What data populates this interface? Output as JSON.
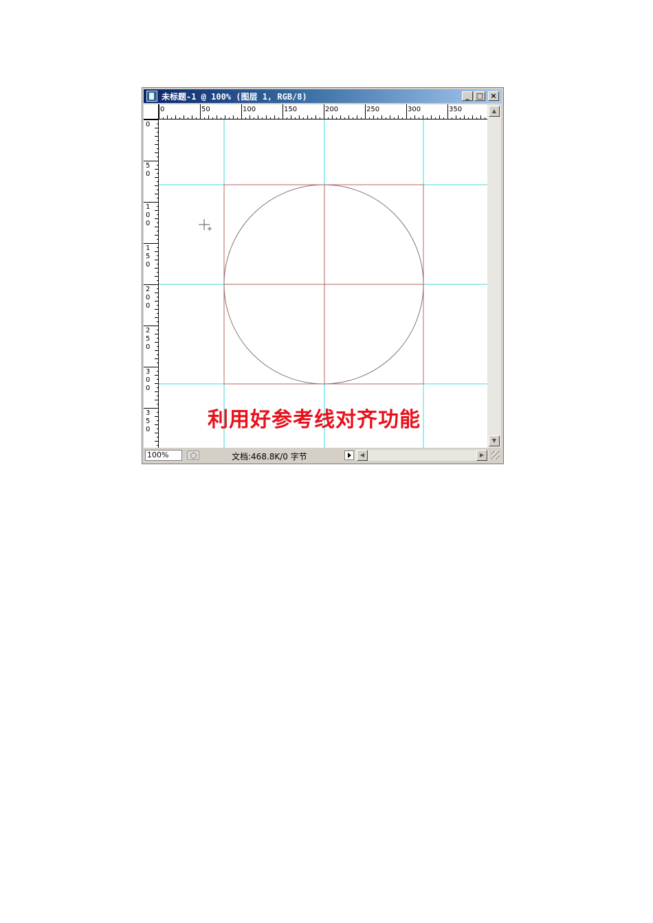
{
  "window": {
    "title": "未标题-1 @ 100% (图层 1, RGB/8)",
    "buttons": {
      "minimize": "_",
      "maximize": "□",
      "close": "×"
    }
  },
  "rulers": {
    "horizontal_labels": [
      "0",
      "50",
      "100",
      "150",
      "200",
      "250",
      "300",
      "350"
    ],
    "vertical_labels": [
      [
        "0"
      ],
      [
        "5",
        "0"
      ],
      [
        "1",
        "0",
        "0"
      ],
      [
        "1",
        "5",
        "0"
      ],
      [
        "2",
        "0",
        "0"
      ],
      [
        "2",
        "5",
        "0"
      ],
      [
        "3",
        "0",
        "0"
      ],
      [
        "3",
        "5",
        "0"
      ]
    ]
  },
  "canvas": {
    "overlay_text": "利用好参考线对齐功能",
    "guide_color": "#3fd9d9",
    "shape_color": "#b5645f",
    "caption_color": "#e8101a"
  },
  "status": {
    "zoom": "100%",
    "doc_info": "文档:468.8K/0 字节"
  },
  "icons": {
    "app": "photoshop-document-icon",
    "navigator": "navigator-icon",
    "menu": "play-arrow-icon",
    "cursor": "crosshair-icon"
  }
}
